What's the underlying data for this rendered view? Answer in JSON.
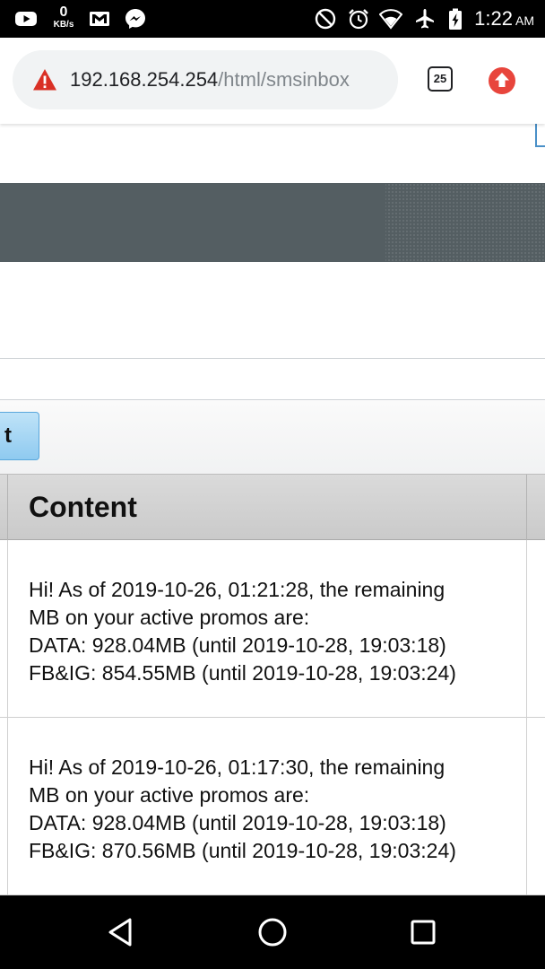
{
  "status_bar": {
    "net_speed_value": "0",
    "net_speed_unit": "KB/s",
    "time": "1:22",
    "ampm": "AM",
    "icons": [
      "youtube-icon",
      "gmail-icon",
      "messenger-icon",
      "do-not-disturb-icon",
      "alarm-icon",
      "wifi-icon",
      "airplane-mode-icon",
      "battery-icon"
    ]
  },
  "browser": {
    "url_host": "192.168.254.254",
    "url_path": "/html/smsinbox",
    "tab_count": "25",
    "security_icon": "not-secure-warning-icon",
    "update_icon": "chrome-update-icon"
  },
  "page": {
    "action_button_label": "t",
    "table": {
      "header": "Content",
      "rows": [
        {
          "lines": [
            "Hi! As of 2019-10-26, 01:21:28, the remaining",
            "MB on your active promos are:",
            "DATA: 928.04MB (until 2019-10-28, 19:03:18)",
            "FB&IG: 854.55MB (until 2019-10-28, 19:03:24)"
          ]
        },
        {
          "lines": [
            "Hi! As of 2019-10-26, 01:17:30, the remaining",
            "MB on your active promos are:",
            "DATA: 928.04MB (until 2019-10-28, 19:03:18)",
            "FB&IG: 870.56MB (until 2019-10-28, 19:03:24)"
          ]
        }
      ]
    }
  },
  "nav_bar": {
    "icons": [
      "back-icon",
      "home-icon",
      "recents-icon"
    ]
  },
  "colors": {
    "status_bar_bg": "#000000",
    "omnibox_bg": "#f1f3f4",
    "warning_red": "#d93025",
    "update_red": "#e8453c",
    "banner_gray": "#545e62",
    "button_blue": "#8fcaf0",
    "table_header_bg": "#d3d3d3"
  }
}
